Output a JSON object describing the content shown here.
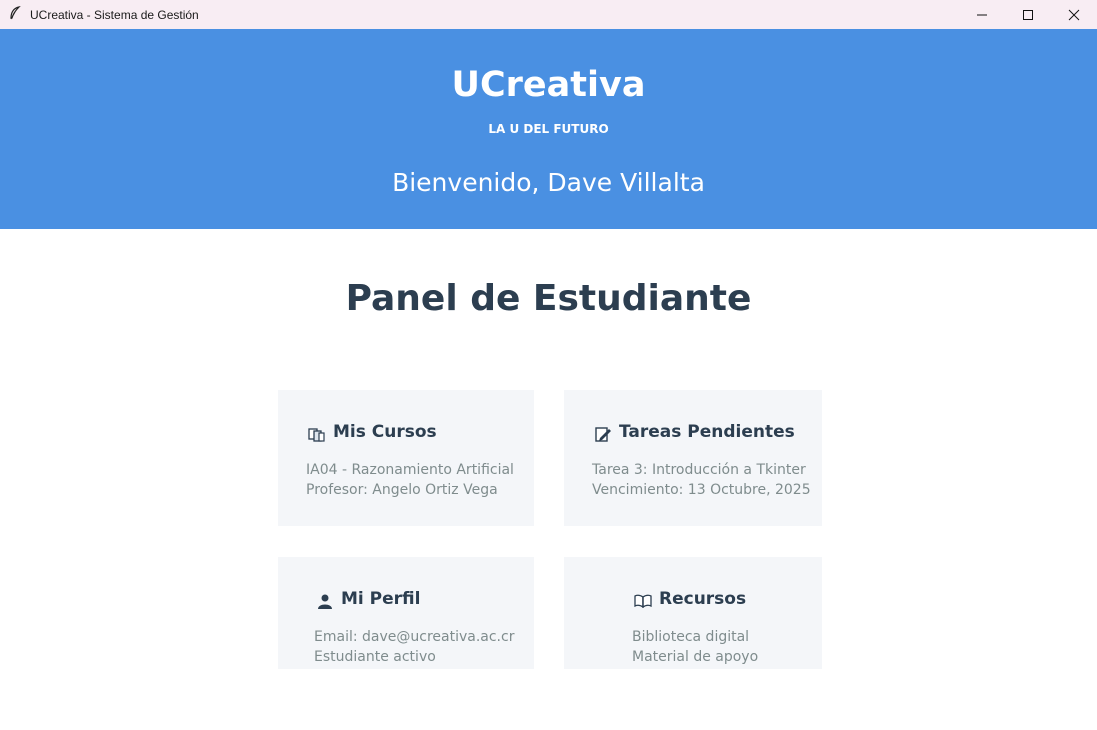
{
  "window": {
    "title": "UCreativa - Sistema de Gestión",
    "app_icon": "feather-icon",
    "controls": [
      "minimize-icon",
      "maximize-icon",
      "close-icon"
    ]
  },
  "header": {
    "brand": "UCreativa",
    "tagline": "LA U DEL FUTURO",
    "welcome": "Bienvenido, Dave Villalta"
  },
  "main": {
    "title": "Panel de Estudiante",
    "cards": [
      {
        "icon": "books-icon",
        "title": "Mis Cursos",
        "lines": [
          "IA04 - Razonamiento Artificial",
          "Profesor: Angelo Ortiz Vega"
        ]
      },
      {
        "icon": "edit-document-icon",
        "title": "Tareas Pendientes",
        "lines": [
          "Tarea 3: Introducción a Tkinter",
          "Vencimiento: 13 Octubre, 2025"
        ]
      },
      {
        "icon": "user-icon",
        "title": "Mi Perfil",
        "lines": [
          "Email: dave@ucreativa.ac.cr",
          "Estudiante activo"
        ]
      },
      {
        "icon": "open-book-icon",
        "title": "Recursos",
        "lines": [
          "Biblioteca digital",
          "Material de apoyo"
        ]
      }
    ]
  },
  "colors": {
    "header_bg": "#4a90e2",
    "card_bg": "#f4f6f9",
    "title_text": "#2c3e50",
    "muted_text": "#7f8c8d",
    "titlebar_bg": "#f8edf3"
  }
}
